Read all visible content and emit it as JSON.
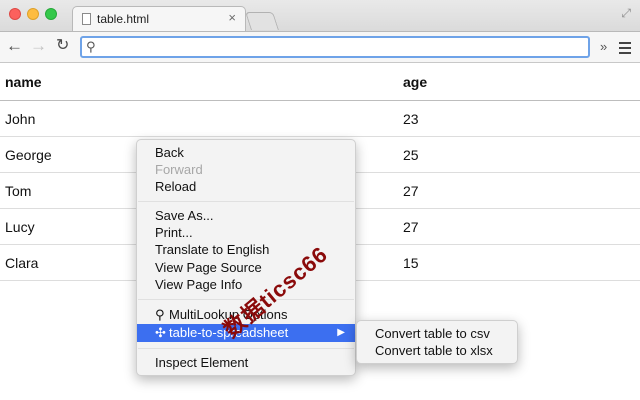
{
  "window": {
    "tab_title": "table.html",
    "tab_close": "×",
    "colors": {
      "close": "#fc615d",
      "minimize": "#fdbc40",
      "maximize": "#34c84a",
      "omnibox_focus": "#6fa3e8",
      "menu_highlight": "#3c6ff0"
    }
  },
  "toolbar": {
    "back_icon": "←",
    "forward_icon": "→",
    "reload_icon": "↻",
    "search_icon": "⚲",
    "omnibox_value": "",
    "extensions_chevron": "»"
  },
  "table": {
    "headers": [
      "name",
      "age"
    ],
    "rows": [
      [
        "John",
        "23"
      ],
      [
        "George",
        "25"
      ],
      [
        "Tom",
        "27"
      ],
      [
        "Lucy",
        "27"
      ],
      [
        "Clara",
        "15"
      ]
    ]
  },
  "context_menu": {
    "back": "Back",
    "forward": "Forward",
    "reload": "Reload",
    "save_as": "Save As...",
    "print": "Print...",
    "translate": "Translate to English",
    "view_source": "View Page Source",
    "view_info": "View Page Info",
    "multilookup": "MultiLookup Options",
    "table_to_spreadsheet": "table-to-spreadsheet",
    "inspect": "Inspect Element",
    "submenu_arrow": "▶"
  },
  "submenu": {
    "csv": "Convert table to csv",
    "xlsx": "Convert table to xlsx"
  },
  "watermark": "数据ticsc66"
}
